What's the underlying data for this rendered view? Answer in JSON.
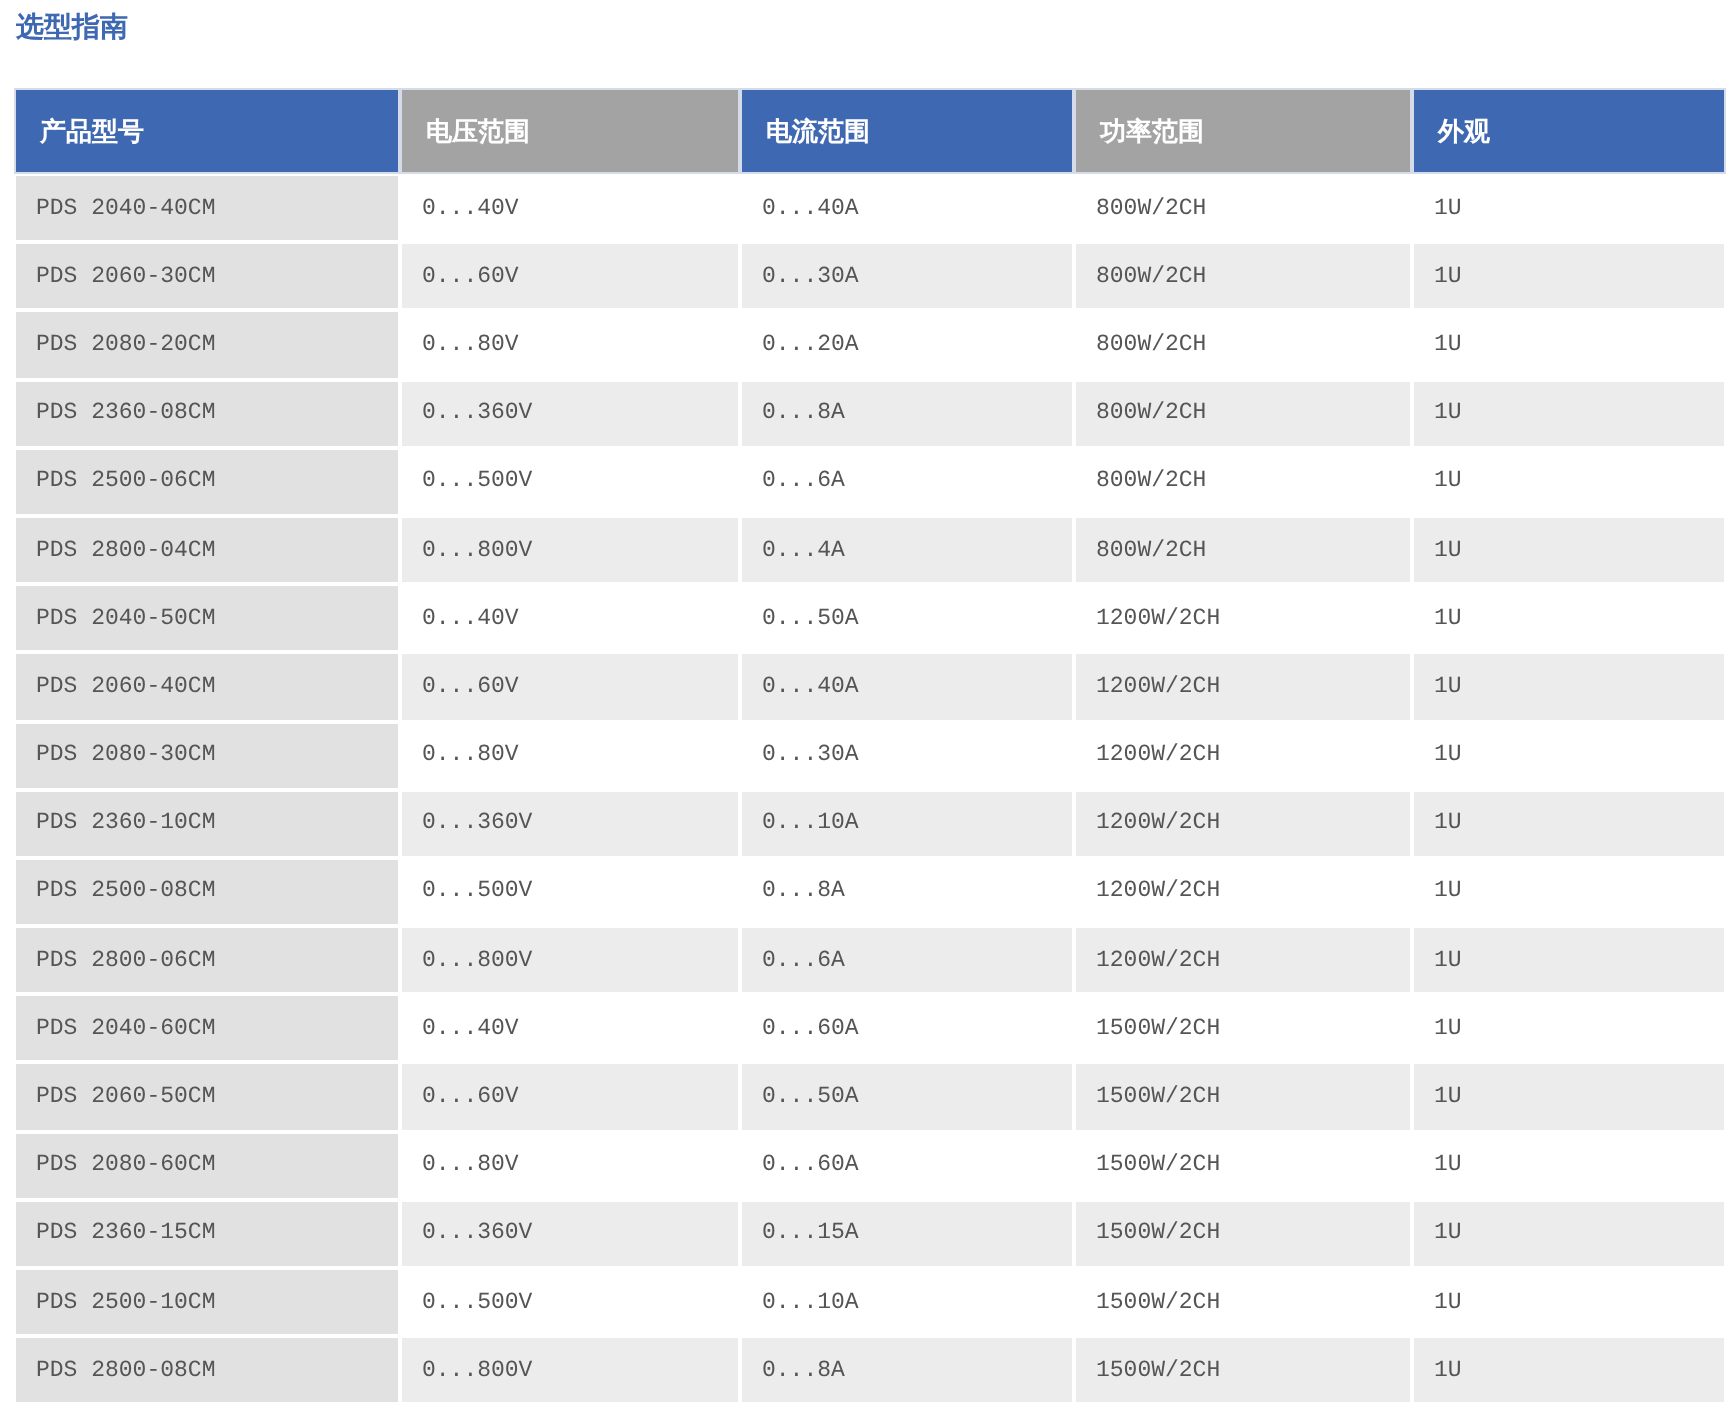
{
  "title": "选型指南",
  "table": {
    "columns": [
      {
        "label": "产品型号",
        "color": "#3f68b2"
      },
      {
        "label": "电压范围",
        "color": "#a3a3a3"
      },
      {
        "label": "电流范围",
        "color": "#3f68b2"
      },
      {
        "label": "功率范围",
        "color": "#a3a3a3"
      },
      {
        "label": "外观",
        "color": "#3f68b2"
      }
    ],
    "rows": [
      [
        "PDS 2040-40CM",
        "0...40V",
        "0...40A",
        "800W/2CH",
        "1U"
      ],
      [
        "PDS 2060-30CM",
        "0...60V",
        "0...30A",
        "800W/2CH",
        "1U"
      ],
      [
        "PDS 2080-20CM",
        "0...80V",
        "0...20A",
        "800W/2CH",
        "1U"
      ],
      [
        "PDS 2360-08CM",
        "0...360V",
        "0...8A",
        "800W/2CH",
        "1U"
      ],
      [
        "PDS 2500-06CM",
        "0...500V",
        "0...6A",
        "800W/2CH",
        "1U"
      ],
      [
        "PDS 2800-04CM",
        "0...800V",
        "0...4A",
        "800W/2CH",
        "1U"
      ],
      [
        "PDS 2040-50CM",
        "0...40V",
        "0...50A",
        "1200W/2CH",
        "1U"
      ],
      [
        "PDS 2060-40CM",
        "0...60V",
        "0...40A",
        "1200W/2CH",
        "1U"
      ],
      [
        "PDS 2080-30CM",
        "0...80V",
        "0...30A",
        "1200W/2CH",
        "1U"
      ],
      [
        "PDS 2360-10CM",
        "0...360V",
        "0...10A",
        "1200W/2CH",
        "1U"
      ],
      [
        "PDS 2500-08CM",
        "0...500V",
        "0...8A",
        "1200W/2CH",
        "1U"
      ],
      [
        "PDS 2800-06CM",
        "0...800V",
        "0...6A",
        "1200W/2CH",
        "1U"
      ],
      [
        "PDS 2040-60CM",
        "0...40V",
        "0...60A",
        "1500W/2CH",
        "1U"
      ],
      [
        "PDS 2060-50CM",
        "0...60V",
        "0...50A",
        "1500W/2CH",
        "1U"
      ],
      [
        "PDS 2080-60CM",
        "0...80V",
        "0...60A",
        "1500W/2CH",
        "1U"
      ],
      [
        "PDS 2360-15CM",
        "0...360V",
        "0...15A",
        "1500W/2CH",
        "1U"
      ],
      [
        "PDS 2500-10CM",
        "0...500V",
        "0...10A",
        "1500W/2CH",
        "1U"
      ],
      [
        "PDS 2800-08CM",
        "0...800V",
        "0...8A",
        "1500W/2CH",
        "1U"
      ]
    ]
  }
}
